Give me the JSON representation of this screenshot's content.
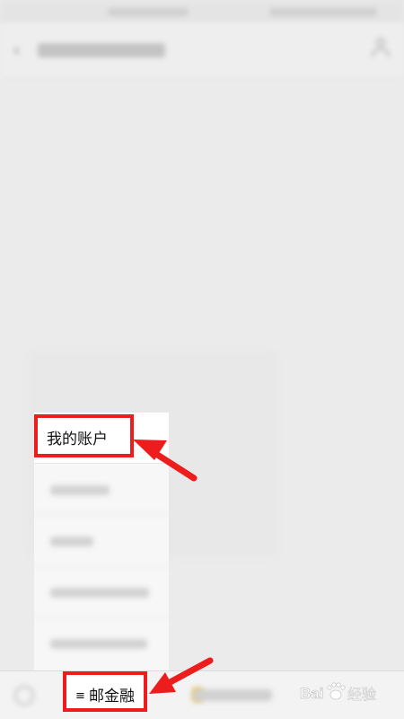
{
  "popup_menu": {
    "items": [
      {
        "label": "我的账户",
        "highlighted": true
      }
    ]
  },
  "bottom_nav": {
    "active_tab": {
      "icon": "hamburger-menu-icon",
      "glyph": "≡",
      "label": "邮金融"
    }
  },
  "watermark": {
    "text": "Bai 经验",
    "icon": "paw-icon"
  },
  "colors": {
    "highlight": "#ee1d1d",
    "background": "#ebebeb",
    "menu_background": "#f7f7f7"
  }
}
